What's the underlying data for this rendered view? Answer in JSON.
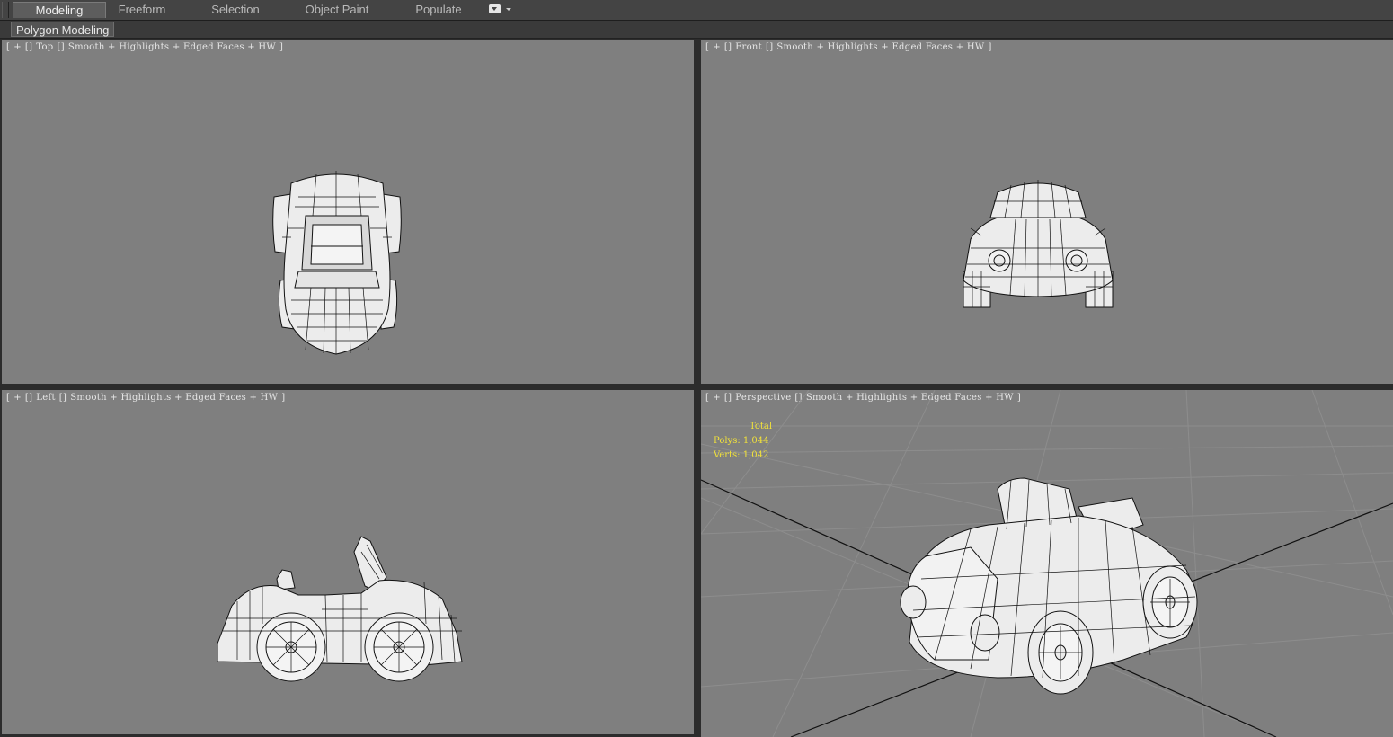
{
  "ribbon": {
    "tabs": [
      {
        "label": "Modeling",
        "active": true
      },
      {
        "label": "Freeform",
        "active": false
      },
      {
        "label": "Selection",
        "active": false
      },
      {
        "label": "Object Paint",
        "active": false
      },
      {
        "label": "Populate",
        "active": false
      }
    ],
    "dropdown_icon": "ribbon-options-icon"
  },
  "subbar": {
    "panel_label": "Polygon Modeling"
  },
  "viewports": {
    "top": {
      "bracket_open": "[",
      "plus": "+",
      "marker": "[]",
      "view": "Top",
      "shading": "Smooth + Highlights + Edged Faces + HW",
      "bracket_close": "]"
    },
    "front": {
      "bracket_open": "[",
      "plus": "+",
      "marker": "[]",
      "view": "Front",
      "shading": "Smooth + Highlights + Edged Faces + HW",
      "bracket_close": "]"
    },
    "left": {
      "bracket_open": "[",
      "plus": "+",
      "marker": "[]",
      "view": "Left",
      "shading": "Smooth + Highlights + Edged Faces + HW",
      "bracket_close": "]"
    },
    "persp": {
      "bracket_open": "[",
      "plus": "+",
      "marker": "[]",
      "view": "Perspective",
      "shading": "Smooth + Highlights + Edged Faces + HW",
      "bracket_close": "]"
    }
  },
  "stats": {
    "title": "Total",
    "polys": "Polys: 1,044",
    "verts": "Verts: 1,042"
  },
  "colors": {
    "viewport_bg": "#7f7f7f",
    "stats_text": "#f2e23a",
    "wire": "#111111",
    "ui_bg": "#444444"
  }
}
